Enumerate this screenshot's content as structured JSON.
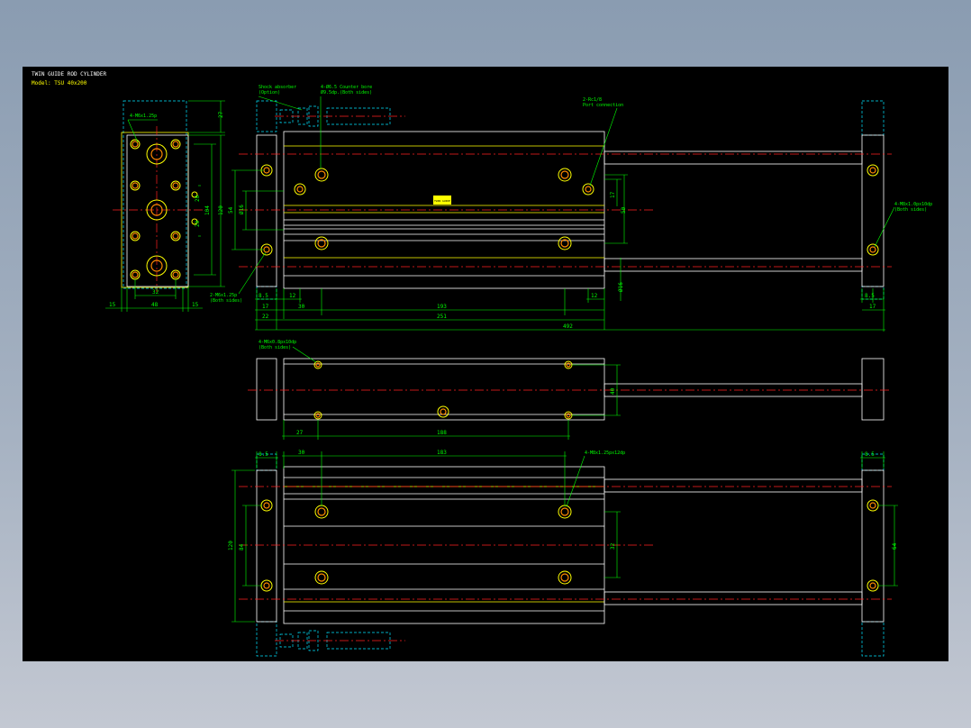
{
  "title": {
    "name": "TWIN GUIDE ROD CYLINDER",
    "model": "Model: TSU 40x200"
  },
  "labels": {
    "front_tap": "4-M6x1.25p",
    "shock_absorber": "Shock absorber",
    "shock_option": "(Option)",
    "counterbore": "4-Ø6.5 Counter bore",
    "counterbore_sub": "Ø9.5dp.(Both sides)",
    "port": "2-Rc1/8",
    "port_sub": "Port connection",
    "side_tap": "2-M6x1.25p",
    "side_tap_sub": "(Both sides)",
    "end_tap": "4-M8x1.0px10dp",
    "end_tap_sub": "(Both sides)",
    "top_tap": "4-M6x0.8px10dp",
    "top_tap_sub": "(Both sides)",
    "bottom_tap": "4-M8x1.25px12dp",
    "nameplate": "TWIN GUIDE"
  },
  "dims": {
    "d27": "27",
    "d15a": "15",
    "d48": "48",
    "d15b": "15",
    "d32": "32",
    "d20a": "20",
    "d104": "104",
    "d120": "120",
    "d20b": "20",
    "d54": "54",
    "dphi16": "Ø16",
    "d17": "17",
    "d50": "50",
    "d55": "Ø16",
    "d8_5": "8.5",
    "d12a": "12",
    "d30": "30",
    "d193": "193",
    "d12b": "12",
    "d17b": "17",
    "d22": "22",
    "d251": "251",
    "d492": "492",
    "d8_5b": "8.5",
    "d17c": "17",
    "d40": "40",
    "d27b": "27",
    "d188": "188",
    "d8_5c": "8.5",
    "d30b": "30",
    "d183": "183",
    "d8_5d": "8.5",
    "d120b": "120",
    "d84": "84",
    "d32b": "32",
    "d64": "64"
  }
}
